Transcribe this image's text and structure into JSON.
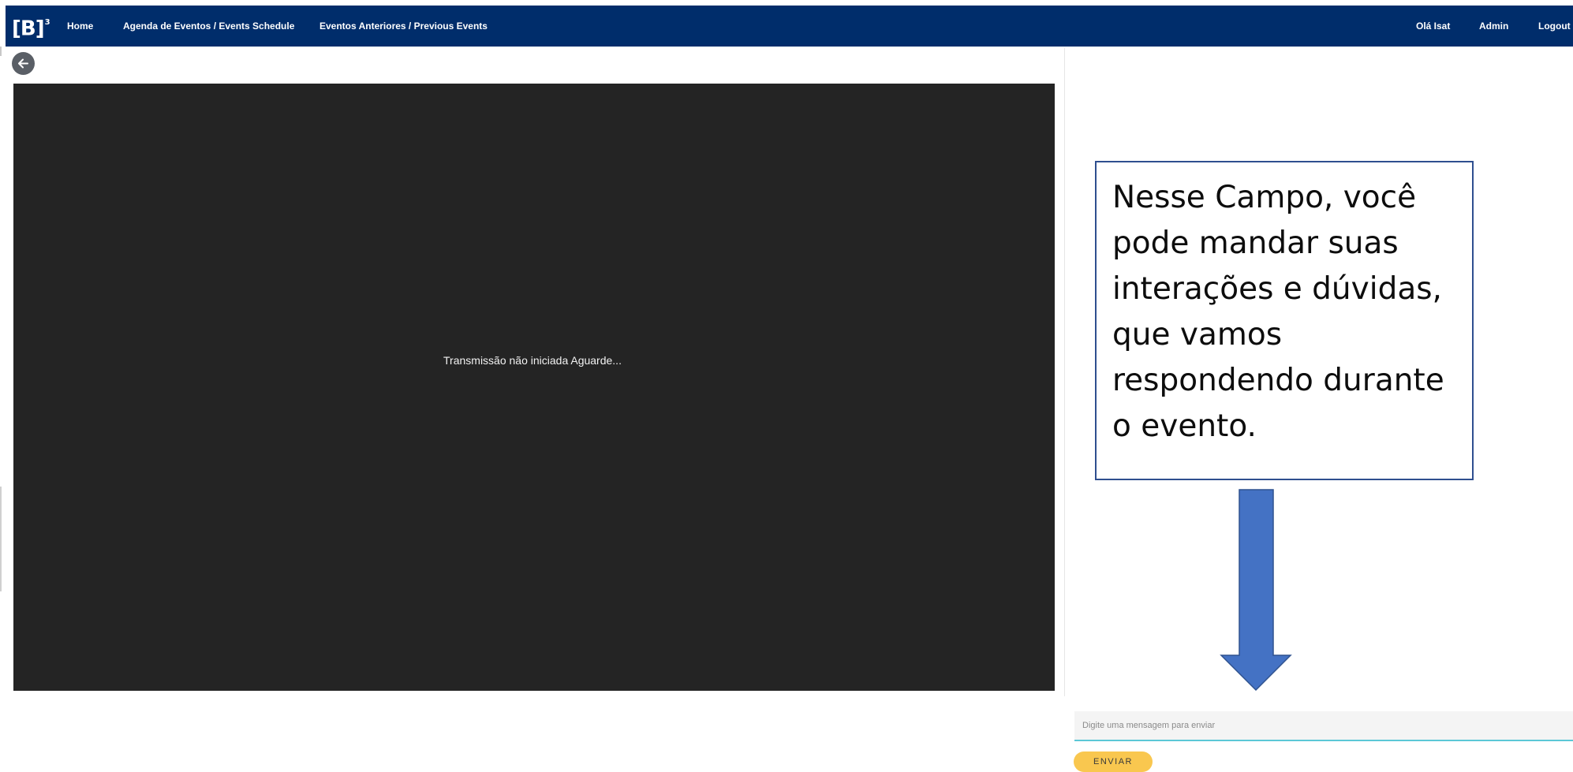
{
  "navbar": {
    "logo": {
      "text": "[B]",
      "superscript": "3"
    },
    "links": [
      {
        "label": "Home"
      },
      {
        "label": "Agenda de Eventos / Events Schedule"
      },
      {
        "label": "Eventos Anteriores / Previous Events"
      }
    ],
    "right_links": [
      {
        "label": "Olá Isat"
      },
      {
        "label": "Admin"
      },
      {
        "label": "Logout"
      }
    ]
  },
  "back_button": {
    "icon": "arrow-left-icon"
  },
  "video": {
    "status_message": "Transmissão não iniciada Aguarde..."
  },
  "callout": {
    "text": "Nesse Campo, você pode mandar suas interações e dúvidas, que vamos respondendo durante o evento.",
    "arrow_icon": "arrow-down-icon"
  },
  "chat": {
    "placeholder": "Digite uma mensagem para enviar",
    "send_label": "ENVIAR"
  },
  "colors": {
    "navbar": "#002d6b",
    "video_bg": "#242424",
    "callout_border": "#2f4f8f",
    "arrow_fill": "#4472c4",
    "send_button": "#f9c74f",
    "input_underline": "#5cc8d6"
  }
}
